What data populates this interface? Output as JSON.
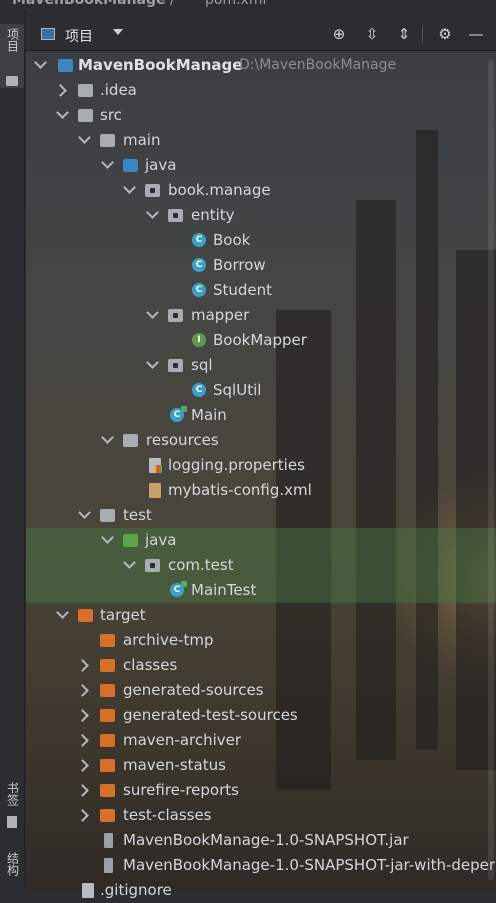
{
  "titlebar": {
    "project": "MavenBookManage",
    "separator": "/",
    "file": "pom.xml"
  },
  "left_strip": {
    "project_tab": "项目",
    "bookmarks_tab": "书签",
    "structure_tab": "结构"
  },
  "header": {
    "view_label": "项目",
    "actions": [
      "locate-icon",
      "expand-all-icon",
      "collapse-all-icon",
      "gear-icon",
      "minimize-icon"
    ]
  },
  "tree": [
    {
      "label": "MavenBookManage",
      "path": "D:\\MavenBookManage",
      "icon": "module-folder",
      "expanded": true
    },
    {
      "label": ".idea",
      "icon": "folder",
      "expanded": false
    },
    {
      "label": "src",
      "icon": "folder",
      "expanded": true
    },
    {
      "label": "main",
      "icon": "folder",
      "expanded": true
    },
    {
      "label": "java",
      "icon": "source-folder",
      "expanded": true
    },
    {
      "label": "book.manage",
      "icon": "package",
      "expanded": true
    },
    {
      "label": "entity",
      "icon": "package",
      "expanded": true
    },
    {
      "label": "Book",
      "icon": "class"
    },
    {
      "label": "Borrow",
      "icon": "class"
    },
    {
      "label": "Student",
      "icon": "class"
    },
    {
      "label": "mapper",
      "icon": "package",
      "expanded": true
    },
    {
      "label": "BookMapper",
      "icon": "interface"
    },
    {
      "label": "sql",
      "icon": "package",
      "expanded": true
    },
    {
      "label": "SqlUtil",
      "icon": "class"
    },
    {
      "label": "Main",
      "icon": "main-class"
    },
    {
      "label": "resources",
      "icon": "resources-folder",
      "expanded": true
    },
    {
      "label": "logging.properties",
      "icon": "properties-file"
    },
    {
      "label": "mybatis-config.xml",
      "icon": "xml-file"
    },
    {
      "label": "test",
      "icon": "folder",
      "expanded": true
    },
    {
      "label": "java",
      "icon": "test-source-folder",
      "expanded": true
    },
    {
      "label": "com.test",
      "icon": "package",
      "expanded": true
    },
    {
      "label": "MainTest",
      "icon": "main-class"
    },
    {
      "label": "target",
      "icon": "excluded-folder",
      "expanded": true
    },
    {
      "label": "archive-tmp",
      "icon": "excluded-folder"
    },
    {
      "label": "classes",
      "icon": "excluded-folder",
      "expanded": false
    },
    {
      "label": "generated-sources",
      "icon": "excluded-folder",
      "expanded": false
    },
    {
      "label": "generated-test-sources",
      "icon": "excluded-folder",
      "expanded": false
    },
    {
      "label": "maven-archiver",
      "icon": "excluded-folder",
      "expanded": false
    },
    {
      "label": "maven-status",
      "icon": "excluded-folder",
      "expanded": false
    },
    {
      "label": "surefire-reports",
      "icon": "excluded-folder",
      "expanded": false
    },
    {
      "label": "test-classes",
      "icon": "excluded-folder",
      "expanded": false
    },
    {
      "label": "MavenBookManage-1.0-SNAPSHOT.jar",
      "icon": "jar-file"
    },
    {
      "label": "MavenBookManage-1.0-SNAPSHOT-jar-with-deper",
      "icon": "jar-file"
    },
    {
      "label": ".gitignore",
      "icon": "file"
    }
  ],
  "colors": {
    "highlight_row": "#487846",
    "folder_orange": "#d7702a",
    "folder_blue": "#3d86c6",
    "class_icon": "#3aa0c8"
  }
}
